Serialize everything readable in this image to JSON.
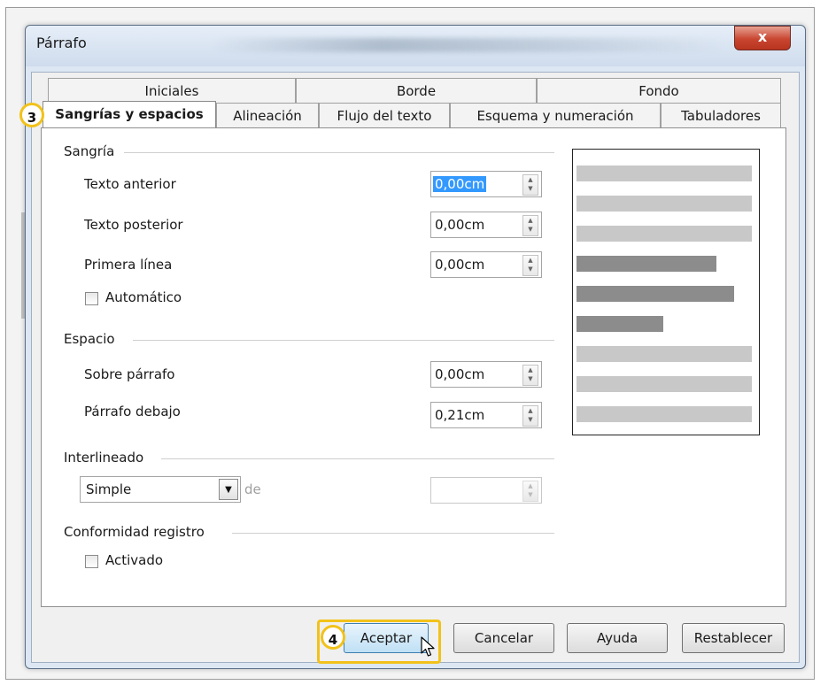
{
  "window": {
    "title": "Párrafo",
    "close_glyph": "x"
  },
  "tabs_row1": [
    {
      "label": "Iniciales"
    },
    {
      "label": "Borde"
    },
    {
      "label": "Fondo"
    }
  ],
  "tabs_row2": [
    {
      "label": "Sangrías y espacios",
      "active": true
    },
    {
      "label": "Alineación"
    },
    {
      "label": "Flujo del texto"
    },
    {
      "label": "Esquema y numeración"
    },
    {
      "label": "Tabuladores"
    }
  ],
  "indent": {
    "group": "Sangría",
    "before_label": "Texto anterior",
    "before_value": "0,00cm",
    "after_label": "Texto posterior",
    "after_value": "0,00cm",
    "first_label": "Primera línea",
    "first_value": "0,00cm",
    "automatic_label": "Automático",
    "automatic_checked": false
  },
  "spacing": {
    "group": "Espacio",
    "above_label": "Sobre párrafo",
    "above_value": "0,00cm",
    "below_label": "Párrafo debajo",
    "below_value": "0,21cm"
  },
  "linespacing": {
    "group": "Interlineado",
    "mode": "Simple",
    "of_label": "de",
    "value": ""
  },
  "register": {
    "group": "Conformidad registro",
    "active_label": "Activado",
    "active_checked": false
  },
  "buttons": {
    "ok": "Aceptar",
    "cancel": "Cancelar",
    "help": "Ayuda",
    "reset": "Restablecer"
  },
  "callouts": {
    "step3": "3",
    "step4": "4"
  },
  "colors": {
    "callout_border": "#f2c21b",
    "preview_light": "#c8c8c8",
    "preview_dark": "#8c8c8c",
    "selection": "#3399ff"
  },
  "icons": {
    "spin": "spin-arrows-icon",
    "dropdown": "dropdown-arrow-icon",
    "cursor": "mouse-pointer-icon"
  }
}
